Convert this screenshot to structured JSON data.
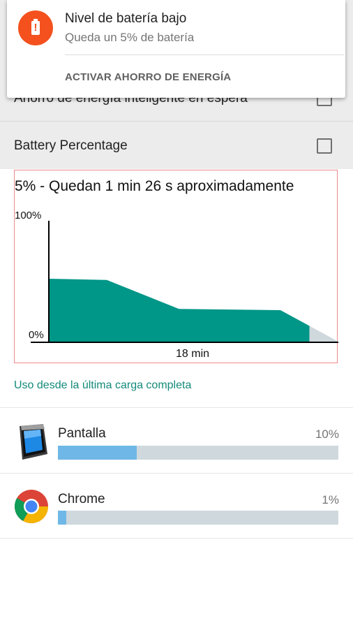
{
  "settings": {
    "row_behind_label": "Ahorro de energía inteligente en espera",
    "battery_percentage_label": "Battery Percentage"
  },
  "notification": {
    "icon": "battery-alert-icon",
    "title": "Nivel de batería bajo",
    "subtitle": "Queda un 5% de batería",
    "action": "ACTIVAR AHORRO DE ENERGÍA"
  },
  "chart_data": {
    "type": "area",
    "title": "5% - Quedan 1 min 26 s aproximadamente",
    "y_tick_labels": [
      "100%",
      "0%"
    ],
    "ylim": [
      0,
      100
    ],
    "xlabel": "18 min",
    "x": [
      0,
      4,
      9,
      16,
      18,
      20
    ],
    "series": [
      {
        "values": [
          52,
          51,
          27,
          26,
          13,
          5
        ]
      }
    ],
    "colors": {
      "fill": "#009688",
      "axis": "#000000",
      "frame": "#f08a8a"
    }
  },
  "usage_link": "Uso desde la última carga completa",
  "apps": [
    {
      "name": "Pantalla",
      "percent_label": "10%",
      "fraction": 0.28,
      "icon": "display-screen-icon"
    },
    {
      "name": "Chrome",
      "percent_label": "1%",
      "fraction": 0.03,
      "icon": "chrome-icon"
    }
  ]
}
